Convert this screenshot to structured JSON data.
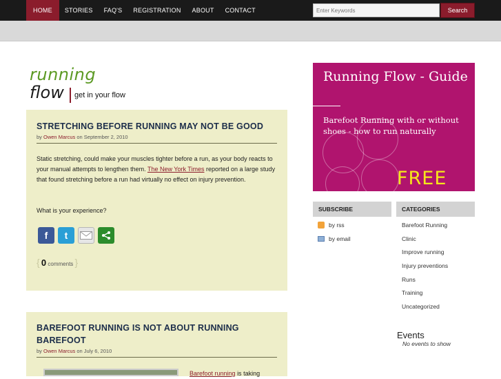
{
  "nav": {
    "items": [
      "HOME",
      "STORIES",
      "FAQ'S",
      "REGISTRATION",
      "ABOUT",
      "CONTACT"
    ],
    "active": "HOME"
  },
  "search": {
    "placeholder": "Enter Keywords",
    "button": "Search"
  },
  "logo": {
    "line1": "running",
    "line2": "flow",
    "tagline": "get in your flow"
  },
  "posts": [
    {
      "title": "STRETCHING BEFORE RUNNING MAY NOT BE GOOD",
      "by": "by",
      "author": "Owen Marcus",
      "on": "on September 2, 2010",
      "body_part1": "Static stretching,  could make your muscles tighter before a run,  as your body reacts to your manual attempts to lengthen them.",
      "body_link": "The New York Times",
      "body_part2": "reported on a large study that found stretching before a run had virtually no effect on injury prevention.",
      "question": "What is your experience?",
      "comment_count": "0",
      "comment_label": "comments"
    },
    {
      "title": "BAREFOOT RUNNING IS NOT ABOUT RUNNING BAREFOOT",
      "by": "by",
      "author": "Owen Marcus",
      "on": "on July 6, 2010",
      "body_link": "Barefoot running",
      "body_rest": "is taking"
    }
  ],
  "share_icons": [
    "facebook-icon",
    "twitter-icon",
    "email-icon",
    "share-icon"
  ],
  "banner": {
    "title": "Running Flow - Guide",
    "subtitle": "Barefoot Running with or without shoes - how to run naturally",
    "free": "FREE",
    "bg_color": "#b0146e"
  },
  "subscribe": {
    "heading": "SUBSCRIBE",
    "items": [
      {
        "label": "by rss",
        "icon": "rss-icon"
      },
      {
        "label": "by email",
        "icon": "email-icon"
      }
    ]
  },
  "categories": {
    "heading": "CATEGORIES",
    "items": [
      "Barefoot Running",
      "Clinic",
      "Improve running",
      "Injury preventions",
      "Runs",
      "Training",
      "Uncategorized"
    ]
  },
  "events": {
    "title": "Events",
    "empty": "No events to show"
  },
  "colors": {
    "accent": "#8b1c2c",
    "post_bg": "#eeeec9",
    "logo_green": "#5c9a24"
  }
}
